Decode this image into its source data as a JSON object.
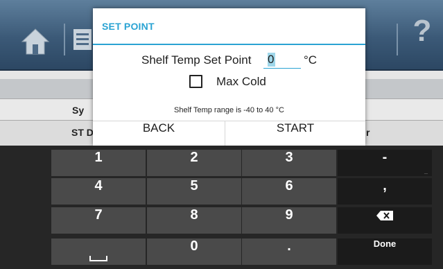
{
  "background": {
    "row2_label": "Sy",
    "row3_left_label": "ST D",
    "row3_right_label": "r",
    "help_glyph": "?"
  },
  "dialog": {
    "title": "SET POINT",
    "setpoint_label": "Shelf Temp Set Point",
    "setpoint_value": "0",
    "setpoint_unit": "°C",
    "max_cold_label": "Max Cold",
    "max_cold_checked": false,
    "range_text": "Shelf Temp range is -40 to 40 °C",
    "back_label": "BACK",
    "start_label": "START"
  },
  "keypad": {
    "keys": [
      "1",
      "2",
      "3",
      "-",
      "4",
      "5",
      "6",
      ",",
      "7",
      "8",
      "9",
      "backspace",
      "space",
      "0",
      ".",
      "Done"
    ],
    "minus_sub": "_",
    "done_label": "Done"
  },
  "colors": {
    "accent": "#2aa3d3",
    "keypad_bg": "#262626",
    "key_bg": "#4a4a4a",
    "key_dark_bg": "#1b1b1b"
  }
}
